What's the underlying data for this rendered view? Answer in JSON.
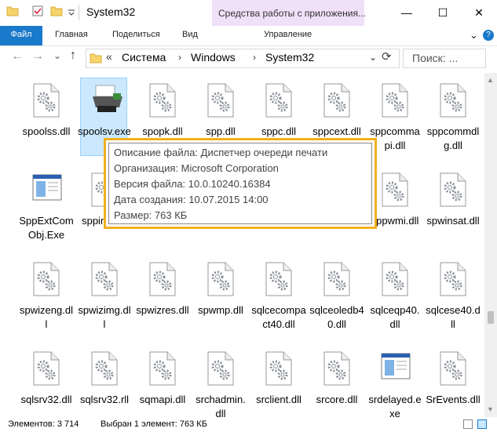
{
  "window": {
    "title": "System32",
    "context_tab": "Средства работы с приложения...",
    "minimize": "—",
    "maximize": "☐",
    "close": "✕"
  },
  "ribbon": {
    "tabs": [
      "Файл",
      "Главная",
      "Поделиться",
      "Вид",
      "Управление"
    ],
    "collapse": "⌄",
    "help": "?"
  },
  "address": {
    "back": "←",
    "forward": "→",
    "recent": "⌄",
    "up": "↑",
    "overflow": "«",
    "crumbs": [
      "Система",
      "Windows",
      "System32"
    ],
    "dropdown": "⌄",
    "refresh": "⟳",
    "search_placeholder": "Поиск: ..."
  },
  "files": [
    {
      "label": "spoolss.dll",
      "icon": "dll-gear-icon"
    },
    {
      "label": "spoolsv.exe",
      "icon": "printer-icon",
      "selected": true
    },
    {
      "label": "spopk.dll",
      "icon": "dll-gear-icon"
    },
    {
      "label": "spp.dll",
      "icon": "dll-gear-icon"
    },
    {
      "label": "sppc.dll",
      "icon": "dll-gear-icon"
    },
    {
      "label": "sppcext.dll",
      "icon": "dll-gear-icon"
    },
    {
      "label": "sppcommapi.dll",
      "icon": "dll-gear-icon"
    },
    {
      "label": "sppcommdlg.dll",
      "icon": "dll-gear-icon"
    },
    {
      "label": "SppExtComObj.Exe",
      "icon": "window-exe-icon"
    },
    {
      "label": "sppinst.dll",
      "icon": "dll-gear-icon"
    },
    {
      "label": "",
      "icon": "dll-gear-icon"
    },
    {
      "label": "",
      "icon": "dll-gear-icon"
    },
    {
      "label": "",
      "icon": "dll-gear-icon"
    },
    {
      "label": "",
      "icon": "dll-gear-icon"
    },
    {
      "label": "sppwmi.dll",
      "icon": "dll-gear-icon"
    },
    {
      "label": "spwinsat.dll",
      "icon": "dll-gear-icon"
    },
    {
      "label": "spwizeng.dll",
      "icon": "dll-gear-icon"
    },
    {
      "label": "spwizimg.dll",
      "icon": "dll-gear-icon"
    },
    {
      "label": "spwizres.dll",
      "icon": "dll-gear-icon"
    },
    {
      "label": "spwmp.dll",
      "icon": "dll-gear-icon"
    },
    {
      "label": "sqlcecompact40.dll",
      "icon": "dll-gear-icon"
    },
    {
      "label": "sqlceoledb40.dll",
      "icon": "dll-gear-icon"
    },
    {
      "label": "sqlceqp40.dll",
      "icon": "dll-gear-icon"
    },
    {
      "label": "sqlcese40.dll",
      "icon": "dll-gear-icon"
    },
    {
      "label": "sqlsrv32.dll",
      "icon": "dll-gear-icon"
    },
    {
      "label": "sqlsrv32.rll",
      "icon": "dll-gear-icon"
    },
    {
      "label": "sqmapi.dll",
      "icon": "dll-gear-icon"
    },
    {
      "label": "srchadmin.dll",
      "icon": "dll-gear-icon"
    },
    {
      "label": "srclient.dll",
      "icon": "dll-gear-icon"
    },
    {
      "label": "srcore.dll",
      "icon": "dll-gear-icon"
    },
    {
      "label": "srdelayed.exe",
      "icon": "window-exe-icon"
    },
    {
      "label": "SrEvents.dll",
      "icon": "dll-gear-icon"
    }
  ],
  "tooltip": {
    "description": "Описание файла: Диспетчер очереди печати",
    "company": "Организация: Microsoft Corporation",
    "version": "Версия файла: 10.0.10240.16384",
    "created": "Дата создания: 10.07.2015 14:00",
    "size": "Размер: 763 КБ"
  },
  "status": {
    "items": "Элементов: 3 714",
    "selected": "Выбран 1 элемент: 763 КБ"
  },
  "colors": {
    "accent": "#1979ca",
    "context_band": "#f0e0f8",
    "selection": "#cce8ff",
    "tooltip_highlight": "#f2b01e"
  }
}
